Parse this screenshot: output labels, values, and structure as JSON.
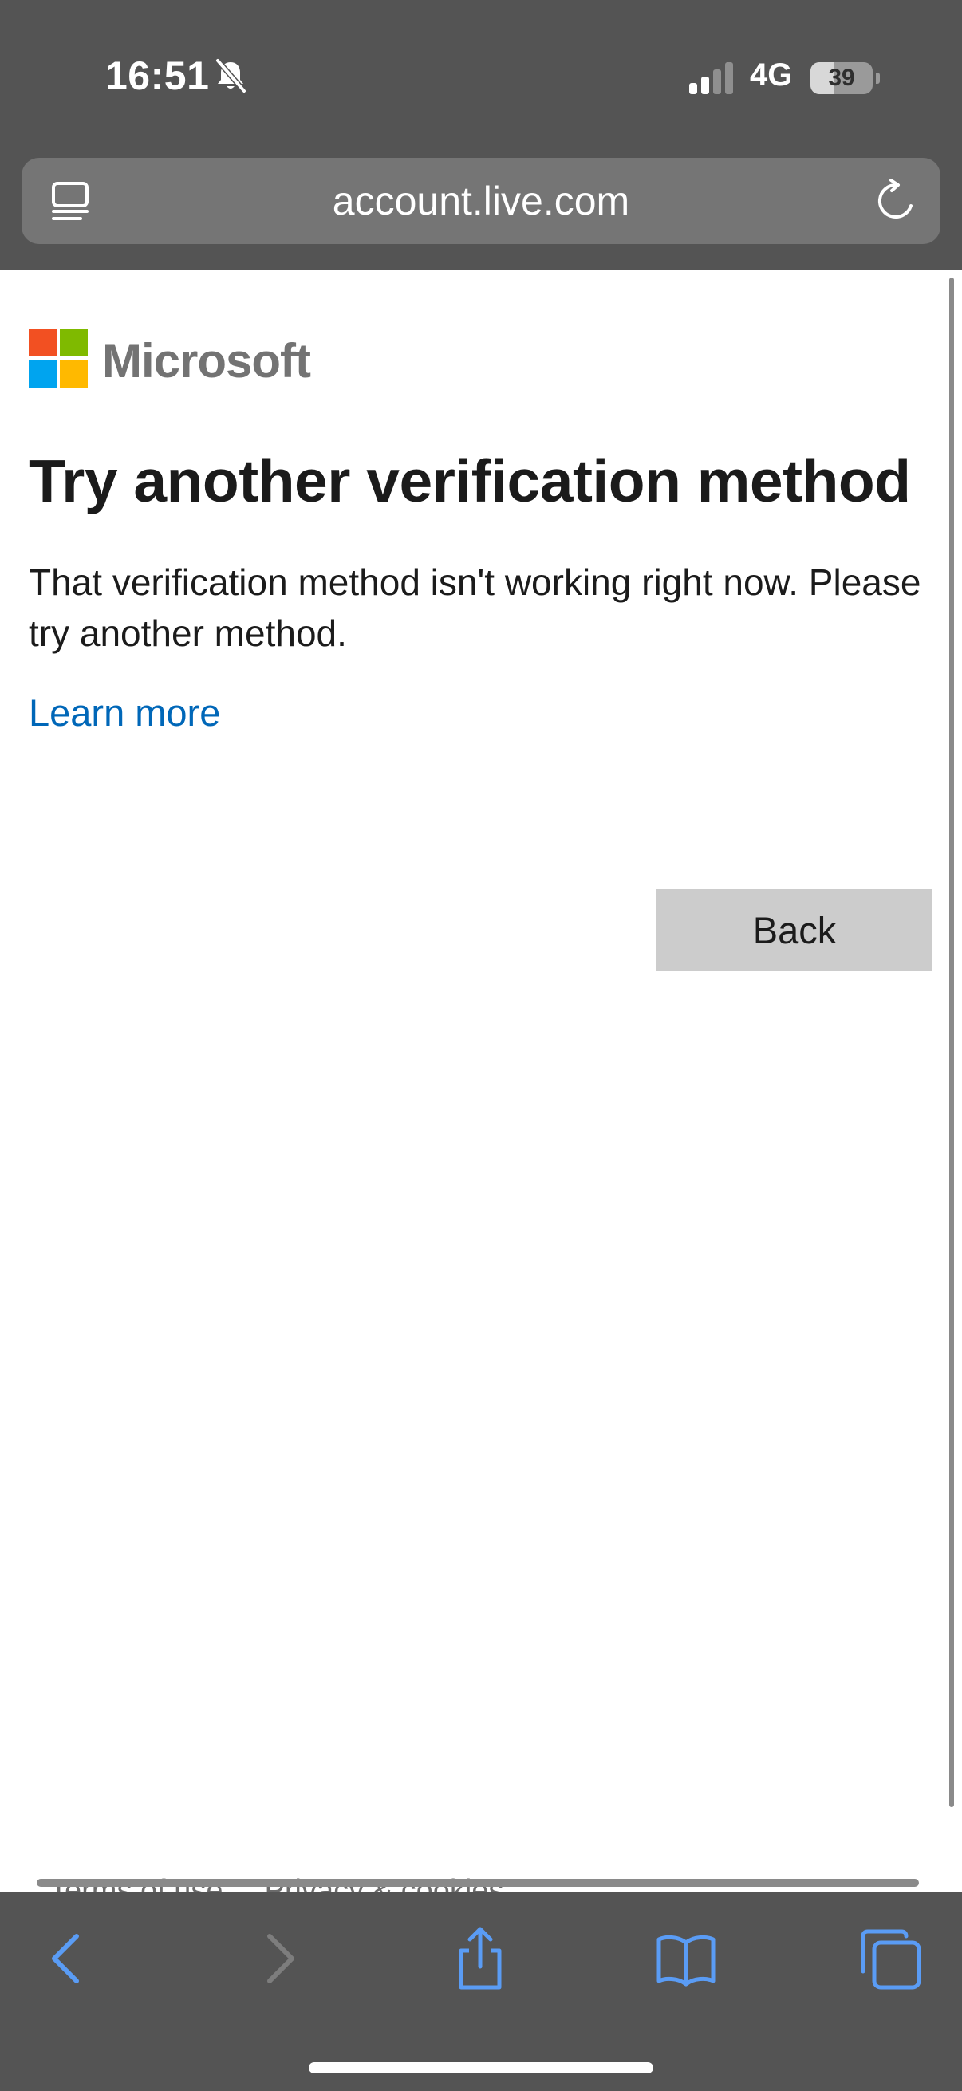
{
  "status_bar": {
    "time": "16:51",
    "network": "4G",
    "battery_level": "39",
    "battery_fraction": 0.39
  },
  "browser": {
    "url": "account.live.com"
  },
  "logo": {
    "name": "Microsoft",
    "colors": [
      "#f25022",
      "#7fba00",
      "#00a4ef",
      "#ffb900"
    ]
  },
  "page": {
    "title": "Try another verification method",
    "message": "That verification method isn't working right now. Please try another method.",
    "learn_more": "Learn more",
    "back_button": "Back"
  },
  "footer": {
    "links": [
      "Terms of use",
      "Privacy & cookies"
    ]
  },
  "toolbar": {
    "items": [
      "back-icon",
      "forward-icon",
      "share-icon",
      "bookmarks-icon",
      "tabs-icon"
    ],
    "accent": "#5a9cf5",
    "disabled": "#7d7d7d"
  },
  "colors": {
    "chrome_background": "#545454",
    "link": "#0067b8",
    "button_background": "#cccccc"
  }
}
